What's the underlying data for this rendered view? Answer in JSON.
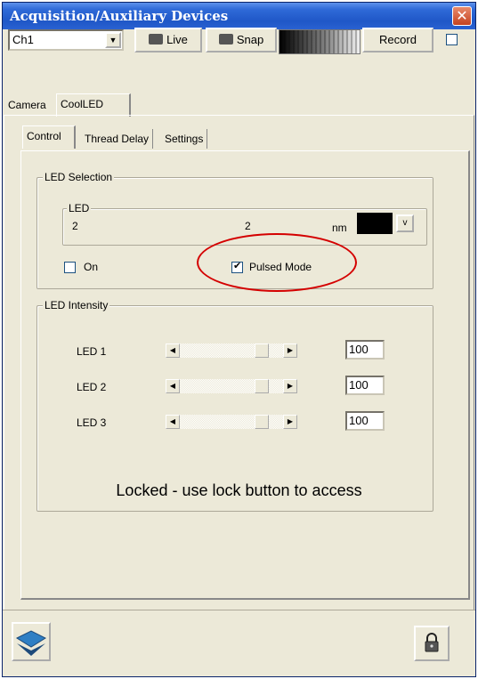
{
  "window": {
    "title": "Acquisition/Auxiliary Devices",
    "close_glyph": "✕"
  },
  "toolbar": {
    "channel_value": "Ch1",
    "live_label": "Live",
    "snap_label": "Snap",
    "record_label": "Record",
    "record_checked": false
  },
  "outer_tabs": [
    {
      "label": "Camera",
      "active": false
    },
    {
      "label": "CoolLED",
      "active": true
    }
  ],
  "inner_tabs": [
    {
      "label": "Control",
      "active": true
    },
    {
      "label": "Thread Delay",
      "active": false
    },
    {
      "label": "Settings",
      "active": false
    }
  ],
  "led_selection": {
    "legend": "LED Selection",
    "led_legend": "LED",
    "led_id": "2",
    "wavelength": "2",
    "unit": "nm",
    "color_button_label": "v",
    "on_label": "On",
    "on_checked": false,
    "pulsed_label": "Pulsed Mode",
    "pulsed_checked": true
  },
  "led_intensity": {
    "legend": "LED Intensity",
    "rows": [
      {
        "label": "LED 1",
        "value": "100"
      },
      {
        "label": "LED 2",
        "value": "100"
      },
      {
        "label": "LED 3",
        "value": "100"
      }
    ]
  },
  "locked_message": "Locked - use lock button to access",
  "annotation": {
    "color": "#d40000"
  }
}
